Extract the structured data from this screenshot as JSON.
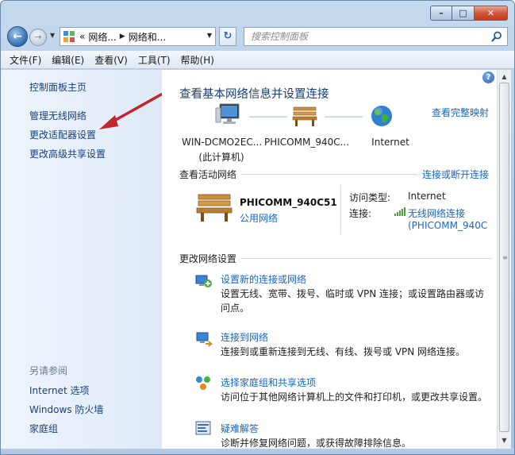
{
  "window": {
    "minimize_label": "–",
    "maximize_label": "□",
    "close_label": "✕"
  },
  "nav": {
    "back_glyph": "←",
    "forward_glyph": "→",
    "address_prefix": "«",
    "address_part1": "网络...",
    "address_part2": "网络和...",
    "refresh_glyph": "↻",
    "search_placeholder": "搜索控制面板"
  },
  "menu": [
    "文件(F)",
    "编辑(E)",
    "查看(V)",
    "工具(T)",
    "帮助(H)"
  ],
  "sidebar": {
    "links": [
      "控制面板主页",
      "管理无线网络",
      "更改适配器设置",
      "更改高级共享设置"
    ],
    "see_also_heading": "另请参阅",
    "see_also": [
      "Internet 选项",
      "Windows 防火墙",
      "家庭组"
    ]
  },
  "content": {
    "title": "查看基本网络信息并设置连接",
    "full_map_link": "查看完整映射",
    "nodes": {
      "computer_name": "WIN-DCMO2EC...",
      "computer_sub": "(此计算机)",
      "network_name": "PHICOMM_940C...",
      "internet": "Internet"
    },
    "active": {
      "heading": "查看活动网络",
      "connect_link": "连接或断开连接",
      "net_name": "PHICOMM_940C51",
      "net_type": "公用网络",
      "access_key": "访问类型:",
      "access_val": "Internet",
      "conn_key": "连接:",
      "conn_link1": "无线网络连接",
      "conn_link2": "(PHICOMM_940C"
    },
    "change_heading": "更改网络设置",
    "tasks": [
      {
        "title": "设置新的连接或网络",
        "desc": "设置无线、宽带、拨号、临时或 VPN 连接；或设置路由器或访问点。"
      },
      {
        "title": "连接到网络",
        "desc": "连接到或重新连接到无线、有线、拨号或 VPN 网络连接。"
      },
      {
        "title": "选择家庭组和共享选项",
        "desc": "访问位于其他网络计算机上的文件和打印机，或更改共享设置。"
      },
      {
        "title": "疑难解答",
        "desc": "诊断并修复网络问题，或获得故障排除信息。"
      }
    ]
  },
  "colors": {
    "link": "#1a64c5",
    "title": "#163e7a",
    "annotation_arrow": "#c0262b"
  }
}
